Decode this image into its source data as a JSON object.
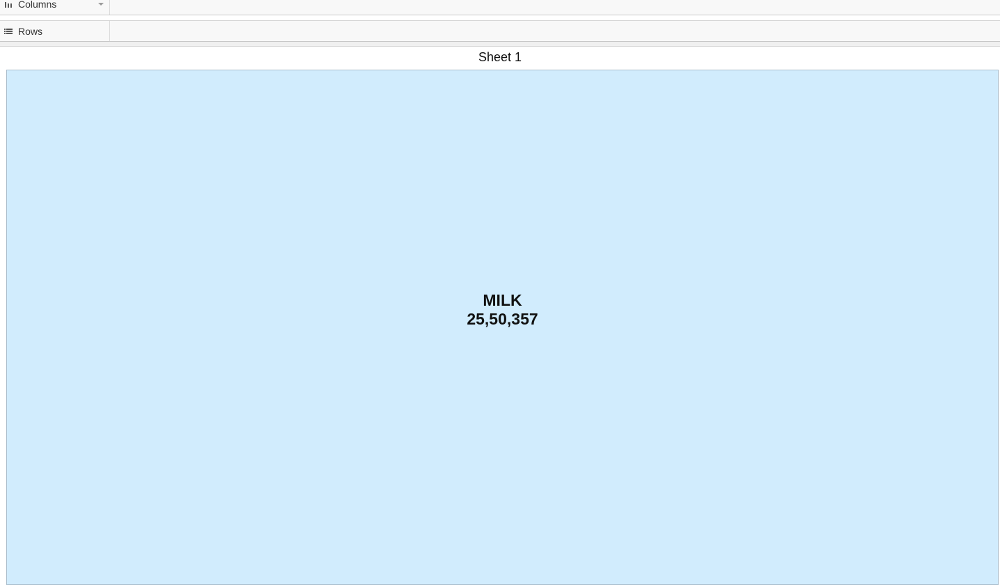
{
  "shelves": {
    "columns": {
      "label": "Columns",
      "icon": "columns-icon"
    },
    "rows": {
      "label": "Rows",
      "icon": "rows-icon"
    }
  },
  "sheet": {
    "title": "Sheet 1"
  },
  "chart_data": {
    "type": "treemap",
    "categories": [
      "MILK"
    ],
    "values": [
      2550357
    ],
    "labels": [
      {
        "category": "MILK",
        "value_text": "25,50,357"
      }
    ],
    "color": "#d1ecfd"
  }
}
